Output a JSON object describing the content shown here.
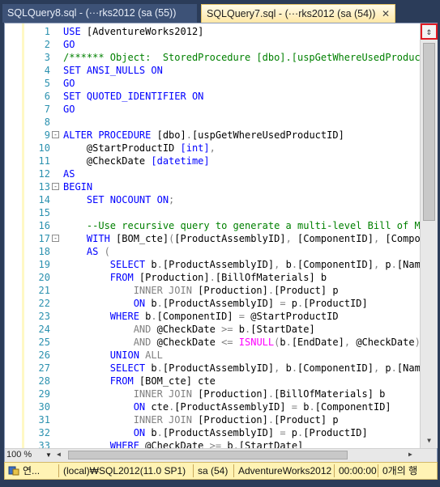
{
  "tabs": [
    {
      "label": "SQLQuery8.sql - (···rks2012 (sa (55))",
      "active": false
    },
    {
      "label": "SQLQuery7.sql - (···rks2012 (sa (54))",
      "active": true,
      "close": "✕"
    }
  ],
  "editor": {
    "lines": [
      {
        "n": "1",
        "t": [
          [
            "kw",
            "USE "
          ],
          [
            "tx",
            "[AdventureWorks2012]"
          ]
        ]
      },
      {
        "n": "2",
        "t": [
          [
            "kw",
            "GO"
          ]
        ]
      },
      {
        "n": "3",
        "t": [
          [
            "cm",
            "/****** Object:  StoredProcedure [dbo].[uspGetWhereUsedProductID]"
          ]
        ]
      },
      {
        "n": "4",
        "t": [
          [
            "kw",
            "SET ANSI_NULLS ON"
          ]
        ]
      },
      {
        "n": "5",
        "t": [
          [
            "kw",
            "GO"
          ]
        ]
      },
      {
        "n": "6",
        "t": [
          [
            "kw",
            "SET QUOTED_IDENTIFIER ON"
          ]
        ]
      },
      {
        "n": "7",
        "t": [
          [
            "kw",
            "GO"
          ]
        ]
      },
      {
        "n": "8",
        "t": []
      },
      {
        "n": "9",
        "fold": "-",
        "t": [
          [
            "kw",
            "ALTER PROCEDURE "
          ],
          [
            "tx",
            "[dbo]"
          ],
          [
            "gr",
            "."
          ],
          [
            "tx",
            "[uspGetWhereUsedProductID]"
          ]
        ]
      },
      {
        "n": "10",
        "t": [
          [
            "tx",
            "    @StartProductID "
          ],
          [
            "kw",
            "[int]"
          ],
          [
            "gr",
            ","
          ]
        ]
      },
      {
        "n": "11",
        "t": [
          [
            "tx",
            "    @CheckDate "
          ],
          [
            "kw",
            "[datetime]"
          ]
        ]
      },
      {
        "n": "12",
        "t": [
          [
            "kw",
            "AS"
          ]
        ]
      },
      {
        "n": "13",
        "fold": "-",
        "t": [
          [
            "kw",
            "BEGIN"
          ]
        ]
      },
      {
        "n": "14",
        "t": [
          [
            "kw",
            "    SET NOCOUNT ON"
          ],
          [
            "gr",
            ";"
          ]
        ]
      },
      {
        "n": "15",
        "t": []
      },
      {
        "n": "16",
        "t": [
          [
            "cm",
            "    --Use recursive query to generate a multi-level Bill of Materials"
          ]
        ]
      },
      {
        "n": "17",
        "fold": "-",
        "t": [
          [
            "kw",
            "    WITH "
          ],
          [
            "tx",
            "[BOM_cte]"
          ],
          [
            "gr",
            "("
          ],
          [
            "tx",
            "[ProductAssemblyID]"
          ],
          [
            "gr",
            ", "
          ],
          [
            "tx",
            "[ComponentID]"
          ],
          [
            "gr",
            ", "
          ],
          [
            "tx",
            "[ComponentDesc]"
          ]
        ]
      },
      {
        "n": "18",
        "t": [
          [
            "kw",
            "    AS "
          ],
          [
            "gr",
            "("
          ]
        ]
      },
      {
        "n": "19",
        "t": [
          [
            "kw",
            "        SELECT "
          ],
          [
            "tx",
            "b"
          ],
          [
            "gr",
            "."
          ],
          [
            "tx",
            "[ProductAssemblyID]"
          ],
          [
            "gr",
            ", "
          ],
          [
            "tx",
            "b"
          ],
          [
            "gr",
            "."
          ],
          [
            "tx",
            "[ComponentID]"
          ],
          [
            "gr",
            ", "
          ],
          [
            "tx",
            "p"
          ],
          [
            "gr",
            "."
          ],
          [
            "tx",
            "[Name]"
          ]
        ]
      },
      {
        "n": "20",
        "t": [
          [
            "kw",
            "        FROM "
          ],
          [
            "tx",
            "[Production]"
          ],
          [
            "gr",
            "."
          ],
          [
            "tx",
            "[BillOfMaterials] b"
          ]
        ]
      },
      {
        "n": "21",
        "t": [
          [
            "gr",
            "            INNER JOIN "
          ],
          [
            "tx",
            "[Production]"
          ],
          [
            "gr",
            "."
          ],
          [
            "tx",
            "[Product] p"
          ]
        ]
      },
      {
        "n": "22",
        "t": [
          [
            "kw",
            "            ON "
          ],
          [
            "tx",
            "b"
          ],
          [
            "gr",
            "."
          ],
          [
            "tx",
            "[ProductAssemblyID] "
          ],
          [
            "gr",
            "= "
          ],
          [
            "tx",
            "p"
          ],
          [
            "gr",
            "."
          ],
          [
            "tx",
            "[ProductID]"
          ]
        ]
      },
      {
        "n": "23",
        "t": [
          [
            "kw",
            "        WHERE "
          ],
          [
            "tx",
            "b"
          ],
          [
            "gr",
            "."
          ],
          [
            "tx",
            "[ComponentID] "
          ],
          [
            "gr",
            "= "
          ],
          [
            "tx",
            "@StartProductID"
          ]
        ]
      },
      {
        "n": "24",
        "t": [
          [
            "gr",
            "            AND "
          ],
          [
            "tx",
            "@CheckDate "
          ],
          [
            "gr",
            ">= "
          ],
          [
            "tx",
            "b"
          ],
          [
            "gr",
            "."
          ],
          [
            "tx",
            "[StartDate]"
          ]
        ]
      },
      {
        "n": "25",
        "t": [
          [
            "gr",
            "            AND "
          ],
          [
            "tx",
            "@CheckDate "
          ],
          [
            "gr",
            "<= "
          ],
          [
            "fn",
            "ISNULL"
          ],
          [
            "gr",
            "("
          ],
          [
            "tx",
            "b"
          ],
          [
            "gr",
            "."
          ],
          [
            "tx",
            "[EndDate]"
          ],
          [
            "gr",
            ", "
          ],
          [
            "tx",
            "@CheckDate"
          ],
          [
            "gr",
            ")"
          ]
        ]
      },
      {
        "n": "26",
        "t": [
          [
            "kw",
            "        UNION "
          ],
          [
            "gr",
            "ALL"
          ]
        ]
      },
      {
        "n": "27",
        "t": [
          [
            "kw",
            "        SELECT "
          ],
          [
            "tx",
            "b"
          ],
          [
            "gr",
            "."
          ],
          [
            "tx",
            "[ProductAssemblyID]"
          ],
          [
            "gr",
            ", "
          ],
          [
            "tx",
            "b"
          ],
          [
            "gr",
            "."
          ],
          [
            "tx",
            "[ComponentID]"
          ],
          [
            "gr",
            ", "
          ],
          [
            "tx",
            "p"
          ],
          [
            "gr",
            "."
          ],
          [
            "tx",
            "[Name]"
          ]
        ]
      },
      {
        "n": "28",
        "t": [
          [
            "kw",
            "        FROM "
          ],
          [
            "tx",
            "[BOM_cte] cte"
          ]
        ]
      },
      {
        "n": "29",
        "t": [
          [
            "gr",
            "            INNER JOIN "
          ],
          [
            "tx",
            "[Production]"
          ],
          [
            "gr",
            "."
          ],
          [
            "tx",
            "[BillOfMaterials] b"
          ]
        ]
      },
      {
        "n": "30",
        "t": [
          [
            "kw",
            "            ON "
          ],
          [
            "tx",
            "cte"
          ],
          [
            "gr",
            "."
          ],
          [
            "tx",
            "[ProductAssemblyID] "
          ],
          [
            "gr",
            "= "
          ],
          [
            "tx",
            "b"
          ],
          [
            "gr",
            "."
          ],
          [
            "tx",
            "[ComponentID]"
          ]
        ]
      },
      {
        "n": "31",
        "t": [
          [
            "gr",
            "            INNER JOIN "
          ],
          [
            "tx",
            "[Production]"
          ],
          [
            "gr",
            "."
          ],
          [
            "tx",
            "[Product] p"
          ]
        ]
      },
      {
        "n": "32",
        "t": [
          [
            "kw",
            "            ON "
          ],
          [
            "tx",
            "b"
          ],
          [
            "gr",
            "."
          ],
          [
            "tx",
            "[ProductAssemblyID] "
          ],
          [
            "gr",
            "= "
          ],
          [
            "tx",
            "p"
          ],
          [
            "gr",
            "."
          ],
          [
            "tx",
            "[ProductID]"
          ]
        ]
      },
      {
        "n": "33",
        "t": [
          [
            "kw",
            "        WHERE "
          ],
          [
            "tx",
            "@CheckDate "
          ],
          [
            "gr",
            ">= "
          ],
          [
            "tx",
            "b"
          ],
          [
            "gr",
            "."
          ],
          [
            "tx",
            "[StartDate]"
          ]
        ]
      }
    ]
  },
  "zoom": {
    "value": "100 %"
  },
  "status": {
    "connection": "연...",
    "server": "(local)₩SQL2012(11.0 SP1)",
    "user": "sa (54)",
    "database": "AdventureWorks2012",
    "time": "00:00:00",
    "rows": "0개의 행"
  },
  "colors": {
    "accent": "#e01a22",
    "status_bg": "#fff3b4",
    "tab_active": "#ffe8a6"
  }
}
